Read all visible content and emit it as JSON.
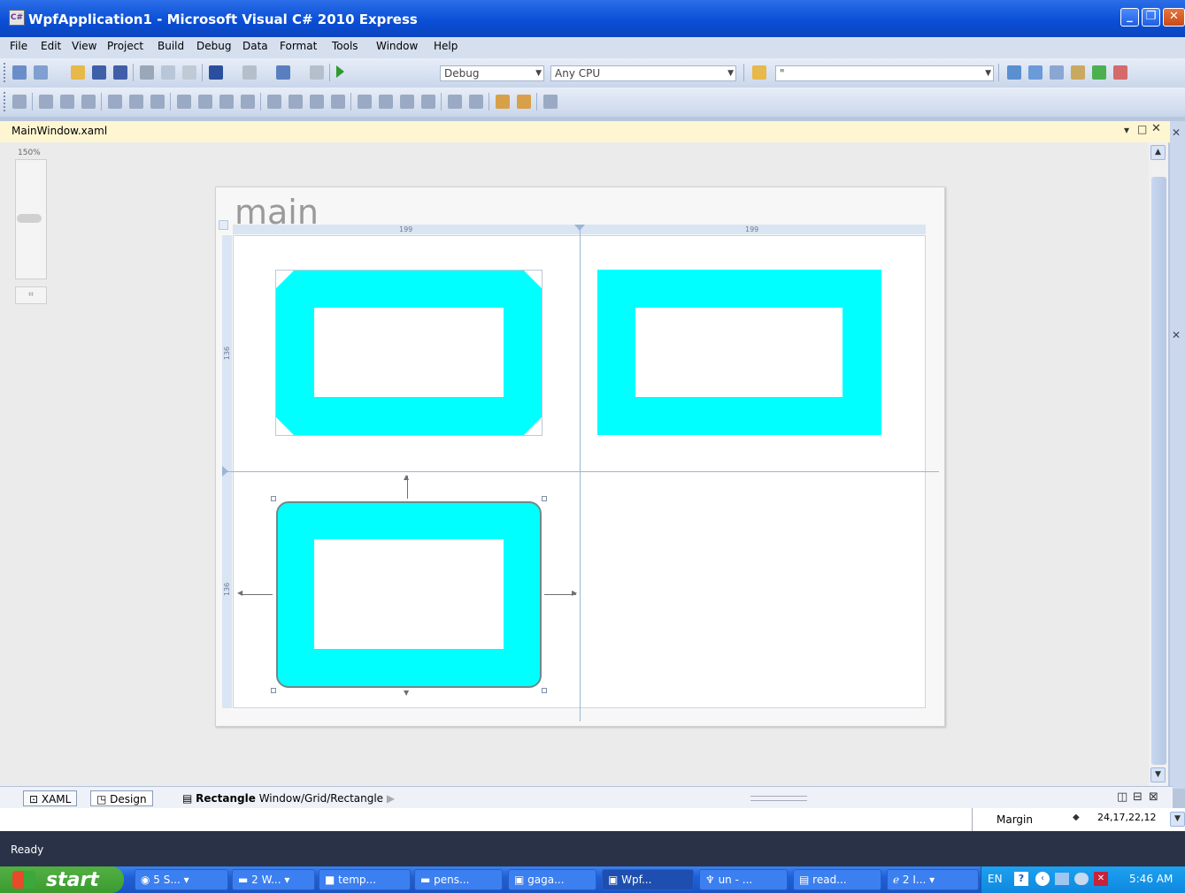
{
  "window": {
    "title": "WpfApplication1 - Microsoft Visual C# 2010 Express"
  },
  "menu": [
    "File",
    "Edit",
    "View",
    "Project",
    "Build",
    "Debug",
    "Data",
    "Format",
    "Tools",
    "Window",
    "Help"
  ],
  "toolbar": {
    "config": "Debug",
    "platform": "Any CPU",
    "search_value": "\""
  },
  "document": {
    "tab_title": "MainWindow.xaml",
    "zoom": "150%"
  },
  "designer": {
    "window_title": "main",
    "col1_width": "199",
    "col2_width": "199",
    "row1_height": "136",
    "row2_height": "136"
  },
  "bottom_tabs": {
    "xaml": "XAML",
    "design": "Design",
    "selected_element": "Rectangle",
    "breadcrumb": "Window/Grid/Rectangle"
  },
  "properties": {
    "name": "Margin",
    "value": "24,17,22,12"
  },
  "status": "Ready",
  "taskbar": {
    "start": "start",
    "tasks": [
      "5 S...",
      "2 W...",
      "temp...",
      "pens...",
      "gaga...",
      "Wpf...",
      "un - ...",
      "read...",
      "2 I..."
    ],
    "lang": "EN",
    "clock": "5:46 AM"
  },
  "colors": {
    "shape_fill": "#00ffff",
    "titlebar": "#0a4fd6",
    "doc_header": "#fdf6d1"
  }
}
